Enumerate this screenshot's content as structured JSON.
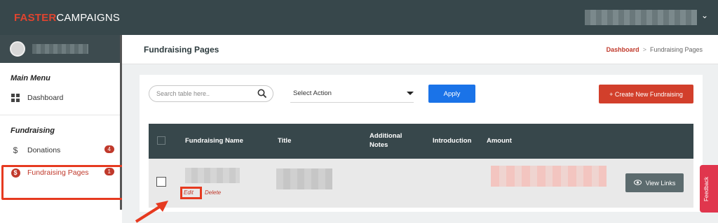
{
  "brand": {
    "part1": "FASTER",
    "part2": "CAMPAIGNS"
  },
  "sidebar": {
    "main_menu_title": "Main Menu",
    "dashboard_label": "Dashboard",
    "fundraising_title": "Fundraising",
    "donations_label": "Donations",
    "donations_count": "4",
    "fundraising_pages_label": "Fundraising Pages",
    "fundraising_pages_count": "1"
  },
  "page": {
    "title": "Fundraising Pages",
    "breadcrumb": {
      "home": "Dashboard",
      "sep": ">",
      "current": "Fundraising Pages"
    }
  },
  "toolbar": {
    "search_placeholder": "Search table here..",
    "select_value": "Select Action",
    "apply_label": "Apply",
    "create_label": "+  Create New Fundraising"
  },
  "table": {
    "columns": [
      "Fundraising Name",
      "Title",
      "Additional Notes",
      "Introduction",
      "Amount"
    ],
    "row": {
      "edit_label": "Edit",
      "delete_label": "Delete",
      "view_label": "View Links"
    }
  },
  "feedback_label": "Feedback",
  "colors": {
    "accent": "#c0392b",
    "topbar": "#37474b",
    "apply": "#1a73e8",
    "highlight": "#e63a20"
  }
}
